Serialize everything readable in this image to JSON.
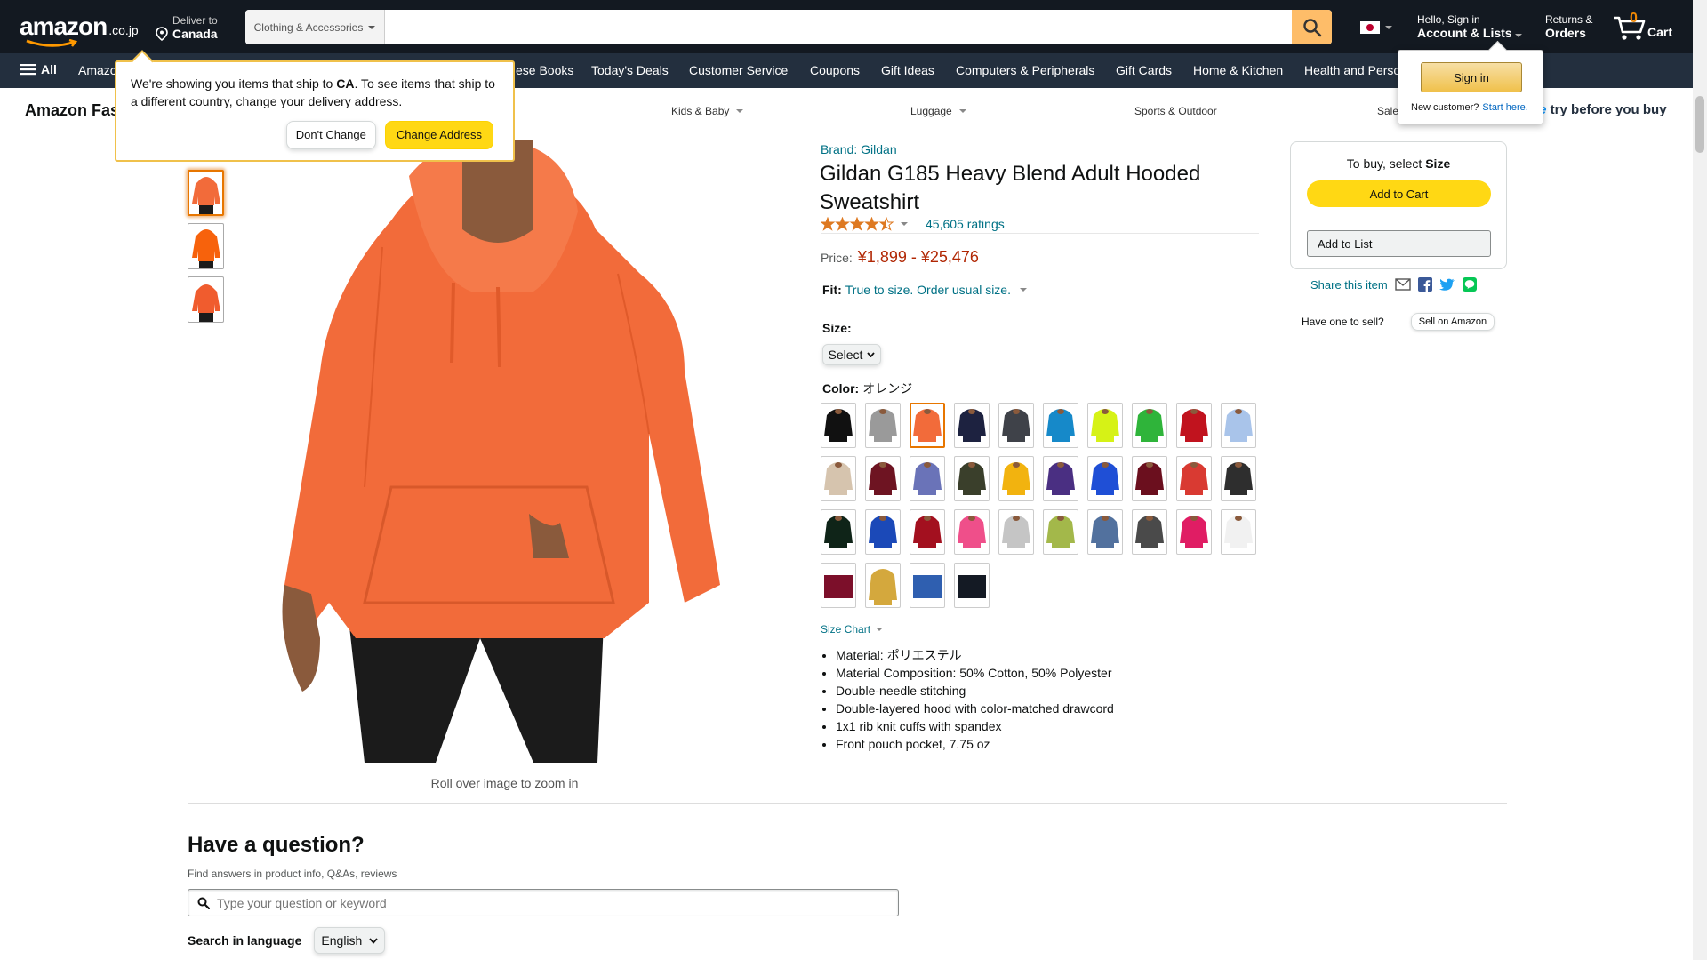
{
  "header": {
    "logo_text": "amazon",
    "logo_tld": ".co.jp",
    "deliver_line1": "Deliver to",
    "deliver_line2": "Canada",
    "search_category": "Clothing & Accessories",
    "search_placeholder": "",
    "account_line1": "Hello, Sign in",
    "account_line2": "Account & Lists",
    "returns_line1": "Returns &",
    "returns_line2": "Orders",
    "cart_count": "0",
    "cart_label": "Cart",
    "flag": "jp-flag-icon"
  },
  "navbar": {
    "all_label": "All",
    "items": [
      "Amazon",
      "Japanese Books",
      "Today's Deals",
      "Customer Service",
      "Coupons",
      "Gift Ideas",
      "Computers & Peripherals",
      "Gift Cards",
      "Home & Kitchen",
      "Health and Personal Care"
    ]
  },
  "navbar_visible": [
    "Amazo",
    "ese Books",
    "Today's Deals",
    "Customer Service",
    "Coupons",
    "Gift Ideas",
    "Computers & Peripherals",
    "Gift Cards",
    "Home & Kitchen",
    "Health and Perso"
  ],
  "subnav": {
    "brand": "Amazon Fas",
    "links": [
      "Kids & Baby",
      "Luggage",
      "Sports & Outdoor",
      "Sale"
    ],
    "promo_prime": "ne",
    "promo_text": " try before you buy"
  },
  "address_popover": {
    "text_before": "We're showing you items that ship to ",
    "country": "CA",
    "text_after": ". To see items that ship to a different country, change your delivery address.",
    "dont_change": "Don't Change",
    "change_address": "Change Address"
  },
  "signin_popover": {
    "button": "Sign in",
    "new_customer": "New customer?",
    "start_here": "Start here."
  },
  "gallery": {
    "thumbnails": [
      "thumb-front",
      "thumb-front-2",
      "thumb-front-3"
    ],
    "zoom_hint": "Roll over image to zoom in",
    "colors": {
      "main": "#f26b3a",
      "pants": "#1b1b1b",
      "skin": "#8a5a3c"
    }
  },
  "product": {
    "brand": "Brand: Gildan",
    "title": "Gildan G185 Heavy Blend Adult Hooded Sweatshirt",
    "rating": 4.5,
    "ratings_count": "45,605 ratings",
    "price_label": "Price:",
    "price_value": "¥1,899 - ¥25,476",
    "fit_label": "Fit:",
    "fit_value": "True to size. Order usual size.",
    "size_label": "Size:",
    "size_select": "Select",
    "color_label": "Color:",
    "color_value": "オレンジ",
    "size_chart": "Size Chart",
    "swatches": [
      "#111111",
      "#9a9a9a",
      "#f26b3a",
      "#1d2240",
      "#3f4249",
      "#1689c9",
      "#d6f216",
      "#2fb43a",
      "#c1131e",
      "#a9c4ea",
      "#d6c4ae",
      "#6e1422",
      "#6a73b8",
      "#3a3f2b",
      "#f2b30f",
      "#4a2f82",
      "#1f4fd6",
      "#6b0f1e",
      "#d93a32",
      "#2e2e2e",
      "#0f2418",
      "#1b49b8",
      "#a3101f",
      "#ef4f8a",
      "#c5c5c5",
      "#a3b84a",
      "#52719e",
      "#4a4a4a",
      "#e01d64",
      "#f1f1f1",
      "#7c0f2a",
      "#d4a83d",
      "#2f5fb0",
      "#141a24"
    ],
    "selected_swatch": 2,
    "bullets": [
      "Material: ポリエステル",
      "Material Composition: 50% Cotton, 50% Polyester",
      "Double-needle stitching",
      "Double-layered hood with color-matched drawcord",
      "1x1 rib knit cuffs with spandex",
      "Front pouch pocket, 7.75 oz"
    ]
  },
  "buybox": {
    "select_prefix": "To buy, select ",
    "select_bold": "Size",
    "add_to_cart": "Add to Cart",
    "add_to_list": "Add to List",
    "share": "Share this item",
    "have_one": "Have one to sell?",
    "sell_btn": "Sell on Amazon"
  },
  "qa": {
    "title": "Have a question?",
    "subtitle": "Find answers in product info, Q&As, reviews",
    "placeholder": "Type your question or keyword",
    "lang_label": "Search in language",
    "lang_value": "English"
  }
}
